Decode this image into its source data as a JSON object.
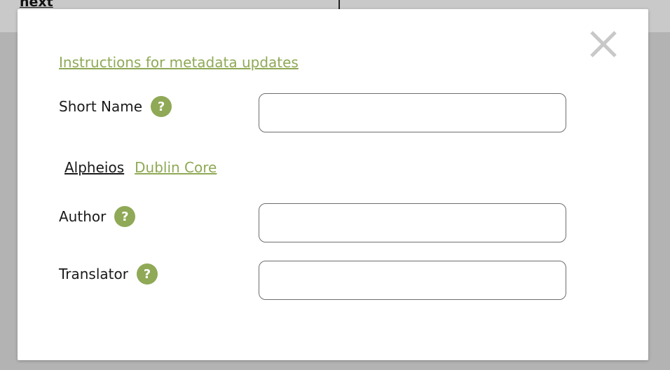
{
  "background": {
    "link_text": "next"
  },
  "modal": {
    "instructions_link": "Instructions for metadata updates",
    "short_name": {
      "label": "Short Name",
      "help": "?",
      "value": ""
    },
    "tabs": [
      {
        "label": "Alpheios",
        "active": true
      },
      {
        "label": "Dublin Core",
        "active": false
      }
    ],
    "author": {
      "label": "Author",
      "help": "?",
      "value": ""
    },
    "translator": {
      "label": "Translator",
      "help": "?",
      "value": ""
    }
  },
  "colors": {
    "accent": "#8fa956",
    "overlay": "#b3b3b3",
    "close_icon": "#c8c8c8"
  },
  "icons": {
    "close": "close-icon",
    "help": "help-icon"
  }
}
